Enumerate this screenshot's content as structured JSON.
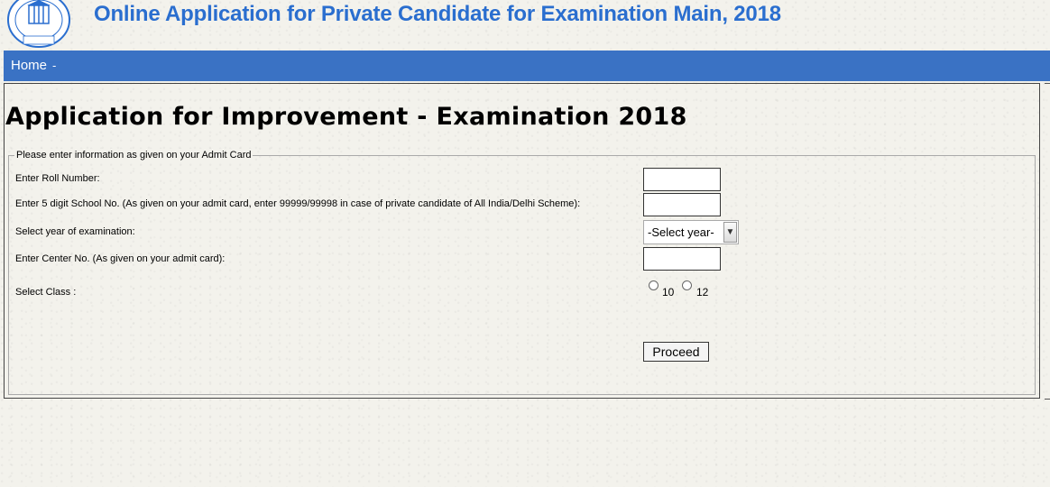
{
  "header": {
    "site_title": "Online Application for Private Candidate for Examination Main, 2018",
    "logo_text": "भारत अंधेरे से उजाले की ओर",
    "logo_motto": "असतो मा सद्गमय"
  },
  "navbar": {
    "home_label": "Home",
    "separator": "-"
  },
  "page": {
    "heading": "Application for Improvement - Examination 2018"
  },
  "form": {
    "legend": "Please enter information as given on your Admit Card",
    "roll_label": "Enter Roll Number:",
    "roll_value": "",
    "school_label": "Enter 5 digit School No. (As given on your admit card, enter 99999/99998 in case of private candidate of All India/Delhi Scheme):",
    "school_value": "",
    "year_label": "Select year of examination:",
    "year_selected": "-Select year-",
    "center_label": "Enter Center No. (As given on your admit card):",
    "center_value": "",
    "class_label": "Select Class :",
    "class_options": [
      "10",
      "12"
    ],
    "submit_label": "Proceed"
  },
  "colors": {
    "title_blue": "#2a6ecf",
    "navbar_blue": "#3a72c4",
    "background": "#f3f2ec"
  },
  "icons": {
    "logo": "cbse-emblem-icon",
    "select_arrow": "chevron-down-icon"
  }
}
